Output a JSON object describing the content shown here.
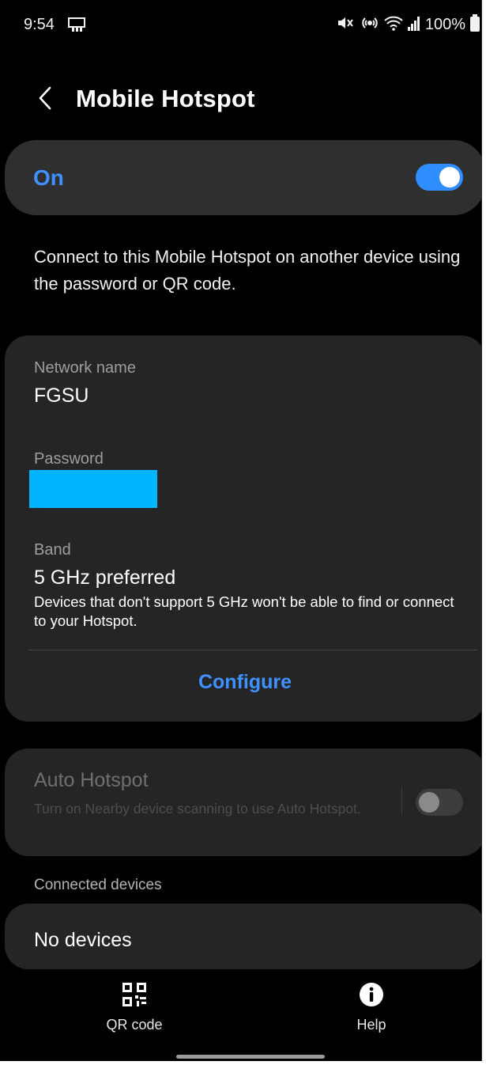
{
  "status_bar": {
    "time": "9:54",
    "battery": "100%",
    "icons": [
      "screen-mirror-icon",
      "mute-icon",
      "hotspot-icon",
      "wifi-icon",
      "signal-icon",
      "battery-icon"
    ]
  },
  "header": {
    "back_icon": "chevron-left-icon",
    "title": "Mobile Hotspot"
  },
  "master_switch": {
    "label": "On",
    "state": true,
    "accent_color": "#3e91ff"
  },
  "description": "Connect to this Mobile Hotspot on another device using the password or QR code.",
  "network": {
    "name_label": "Network name",
    "name_value": "FGSU",
    "password_label": "Password",
    "band_label": "Band",
    "band_value": "5 GHz preferred",
    "band_note": "Devices that don't support 5 GHz won't be able to find or connect to your Hotspot.",
    "configure_label": "Configure"
  },
  "auto_hotspot": {
    "title": "Auto Hotspot",
    "subtitle": "Turn on Nearby device scanning to use Auto Hotspot.",
    "state": false
  },
  "connected_devices": {
    "header": "Connected devices",
    "empty_text": "No devices"
  },
  "bottom_nav": [
    {
      "label": "QR code",
      "icon": "qr-code-icon"
    },
    {
      "label": "Help",
      "icon": "info-icon"
    }
  ]
}
